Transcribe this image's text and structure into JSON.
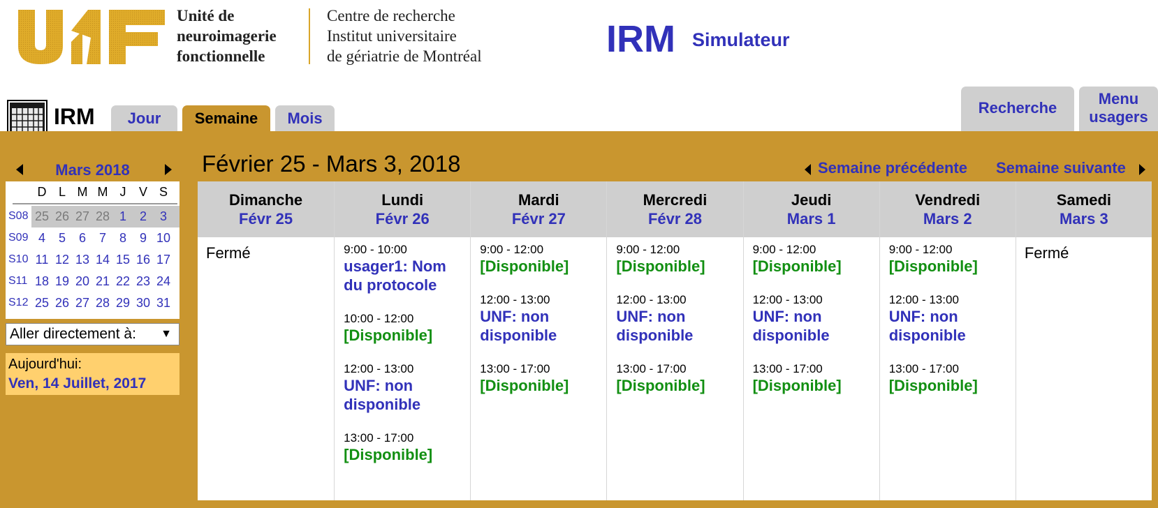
{
  "header": {
    "unit_lines": [
      "Unité de",
      "neuroimagerie",
      "fonctionnelle"
    ],
    "centre_lines": [
      "Centre de recherche",
      "Institut universitaire",
      "de gériatrie de Montréal"
    ],
    "app_title": "IRM",
    "app_subtitle": "Simulateur",
    "logo_color": "#e0ac2a"
  },
  "tabs": {
    "section_label": "IRM",
    "items": [
      {
        "label": "Jour",
        "active": false
      },
      {
        "label": "Semaine",
        "active": true
      },
      {
        "label": "Mois",
        "active": false
      }
    ],
    "recherche": "Recherche",
    "menu_usagers": [
      "Menu",
      "usagers"
    ]
  },
  "mini_calendar": {
    "month_label": "Mars 2018",
    "weekdays": [
      "D",
      "L",
      "M",
      "M",
      "J",
      "V",
      "S"
    ],
    "weeks": [
      {
        "label": "S08",
        "days": [
          "25",
          "26",
          "27",
          "28",
          "1",
          "2",
          "3"
        ],
        "other_month": [
          true,
          true,
          true,
          true,
          false,
          false,
          false
        ]
      },
      {
        "label": "S09",
        "days": [
          "4",
          "5",
          "6",
          "7",
          "8",
          "9",
          "10"
        ],
        "other_month": [
          false,
          false,
          false,
          false,
          false,
          false,
          false
        ]
      },
      {
        "label": "S10",
        "days": [
          "11",
          "12",
          "13",
          "14",
          "15",
          "16",
          "17"
        ],
        "other_month": [
          false,
          false,
          false,
          false,
          false,
          false,
          false
        ]
      },
      {
        "label": "S11",
        "days": [
          "18",
          "19",
          "20",
          "21",
          "22",
          "23",
          "24"
        ],
        "other_month": [
          false,
          false,
          false,
          false,
          false,
          false,
          false
        ]
      },
      {
        "label": "S12",
        "days": [
          "25",
          "26",
          "27",
          "28",
          "29",
          "30",
          "31"
        ],
        "other_month": [
          false,
          false,
          false,
          false,
          false,
          false,
          false
        ]
      }
    ],
    "goto_label": "Aller directement à:",
    "today_label": "Aujourd'hui:",
    "today_date": "Ven, 14 Juillet, 2017"
  },
  "week": {
    "title": "Février 25 - Mars 3, 2018",
    "prev_label": "Semaine précédente",
    "next_label": "Semaine suivante",
    "days": [
      {
        "name": "Dimanche",
        "date": "Févr 25",
        "closed": "Fermé",
        "slots": []
      },
      {
        "name": "Lundi",
        "date": "Févr 26",
        "closed": "",
        "slots": [
          {
            "time": "9:00 - 10:00",
            "label": "usager1: Nom du protocole",
            "status": "busy"
          },
          {
            "time": "10:00 - 12:00",
            "label": "[Disponible]",
            "status": "avail"
          },
          {
            "time": "12:00 - 13:00",
            "label": "UNF: non disponible",
            "status": "busy"
          },
          {
            "time": "13:00 - 17:00",
            "label": "[Disponible]",
            "status": "avail"
          }
        ]
      },
      {
        "name": "Mardi",
        "date": "Févr 27",
        "closed": "",
        "slots": [
          {
            "time": "9:00 - 12:00",
            "label": "[Disponible]",
            "status": "avail"
          },
          {
            "time": "12:00 - 13:00",
            "label": "UNF: non disponible",
            "status": "busy"
          },
          {
            "time": "13:00 - 17:00",
            "label": "[Disponible]",
            "status": "avail"
          }
        ]
      },
      {
        "name": "Mercredi",
        "date": "Févr 28",
        "closed": "",
        "slots": [
          {
            "time": "9:00 - 12:00",
            "label": "[Disponible]",
            "status": "avail"
          },
          {
            "time": "12:00 - 13:00",
            "label": "UNF: non disponible",
            "status": "busy"
          },
          {
            "time": "13:00 - 17:00",
            "label": "[Disponible]",
            "status": "avail"
          }
        ]
      },
      {
        "name": "Jeudi",
        "date": "Mars 1",
        "closed": "",
        "slots": [
          {
            "time": "9:00 - 12:00",
            "label": "[Disponible]",
            "status": "avail"
          },
          {
            "time": "12:00 - 13:00",
            "label": "UNF: non disponible",
            "status": "busy"
          },
          {
            "time": "13:00 - 17:00",
            "label": "[Disponible]",
            "status": "avail"
          }
        ]
      },
      {
        "name": "Vendredi",
        "date": "Mars 2",
        "closed": "",
        "slots": [
          {
            "time": "9:00 - 12:00",
            "label": "[Disponible]",
            "status": "avail"
          },
          {
            "time": "12:00 - 13:00",
            "label": "UNF: non disponible",
            "status": "busy"
          },
          {
            "time": "13:00 - 17:00",
            "label": "[Disponible]",
            "status": "avail"
          }
        ]
      },
      {
        "name": "Samedi",
        "date": "Mars 3",
        "closed": "Fermé",
        "slots": []
      }
    ]
  },
  "colors": {
    "gold": "#c9962f",
    "link_blue": "#3131b9",
    "available_green": "#128f12",
    "tab_gray": "#cfcfcf",
    "today_yellow": "#ffd06e"
  }
}
